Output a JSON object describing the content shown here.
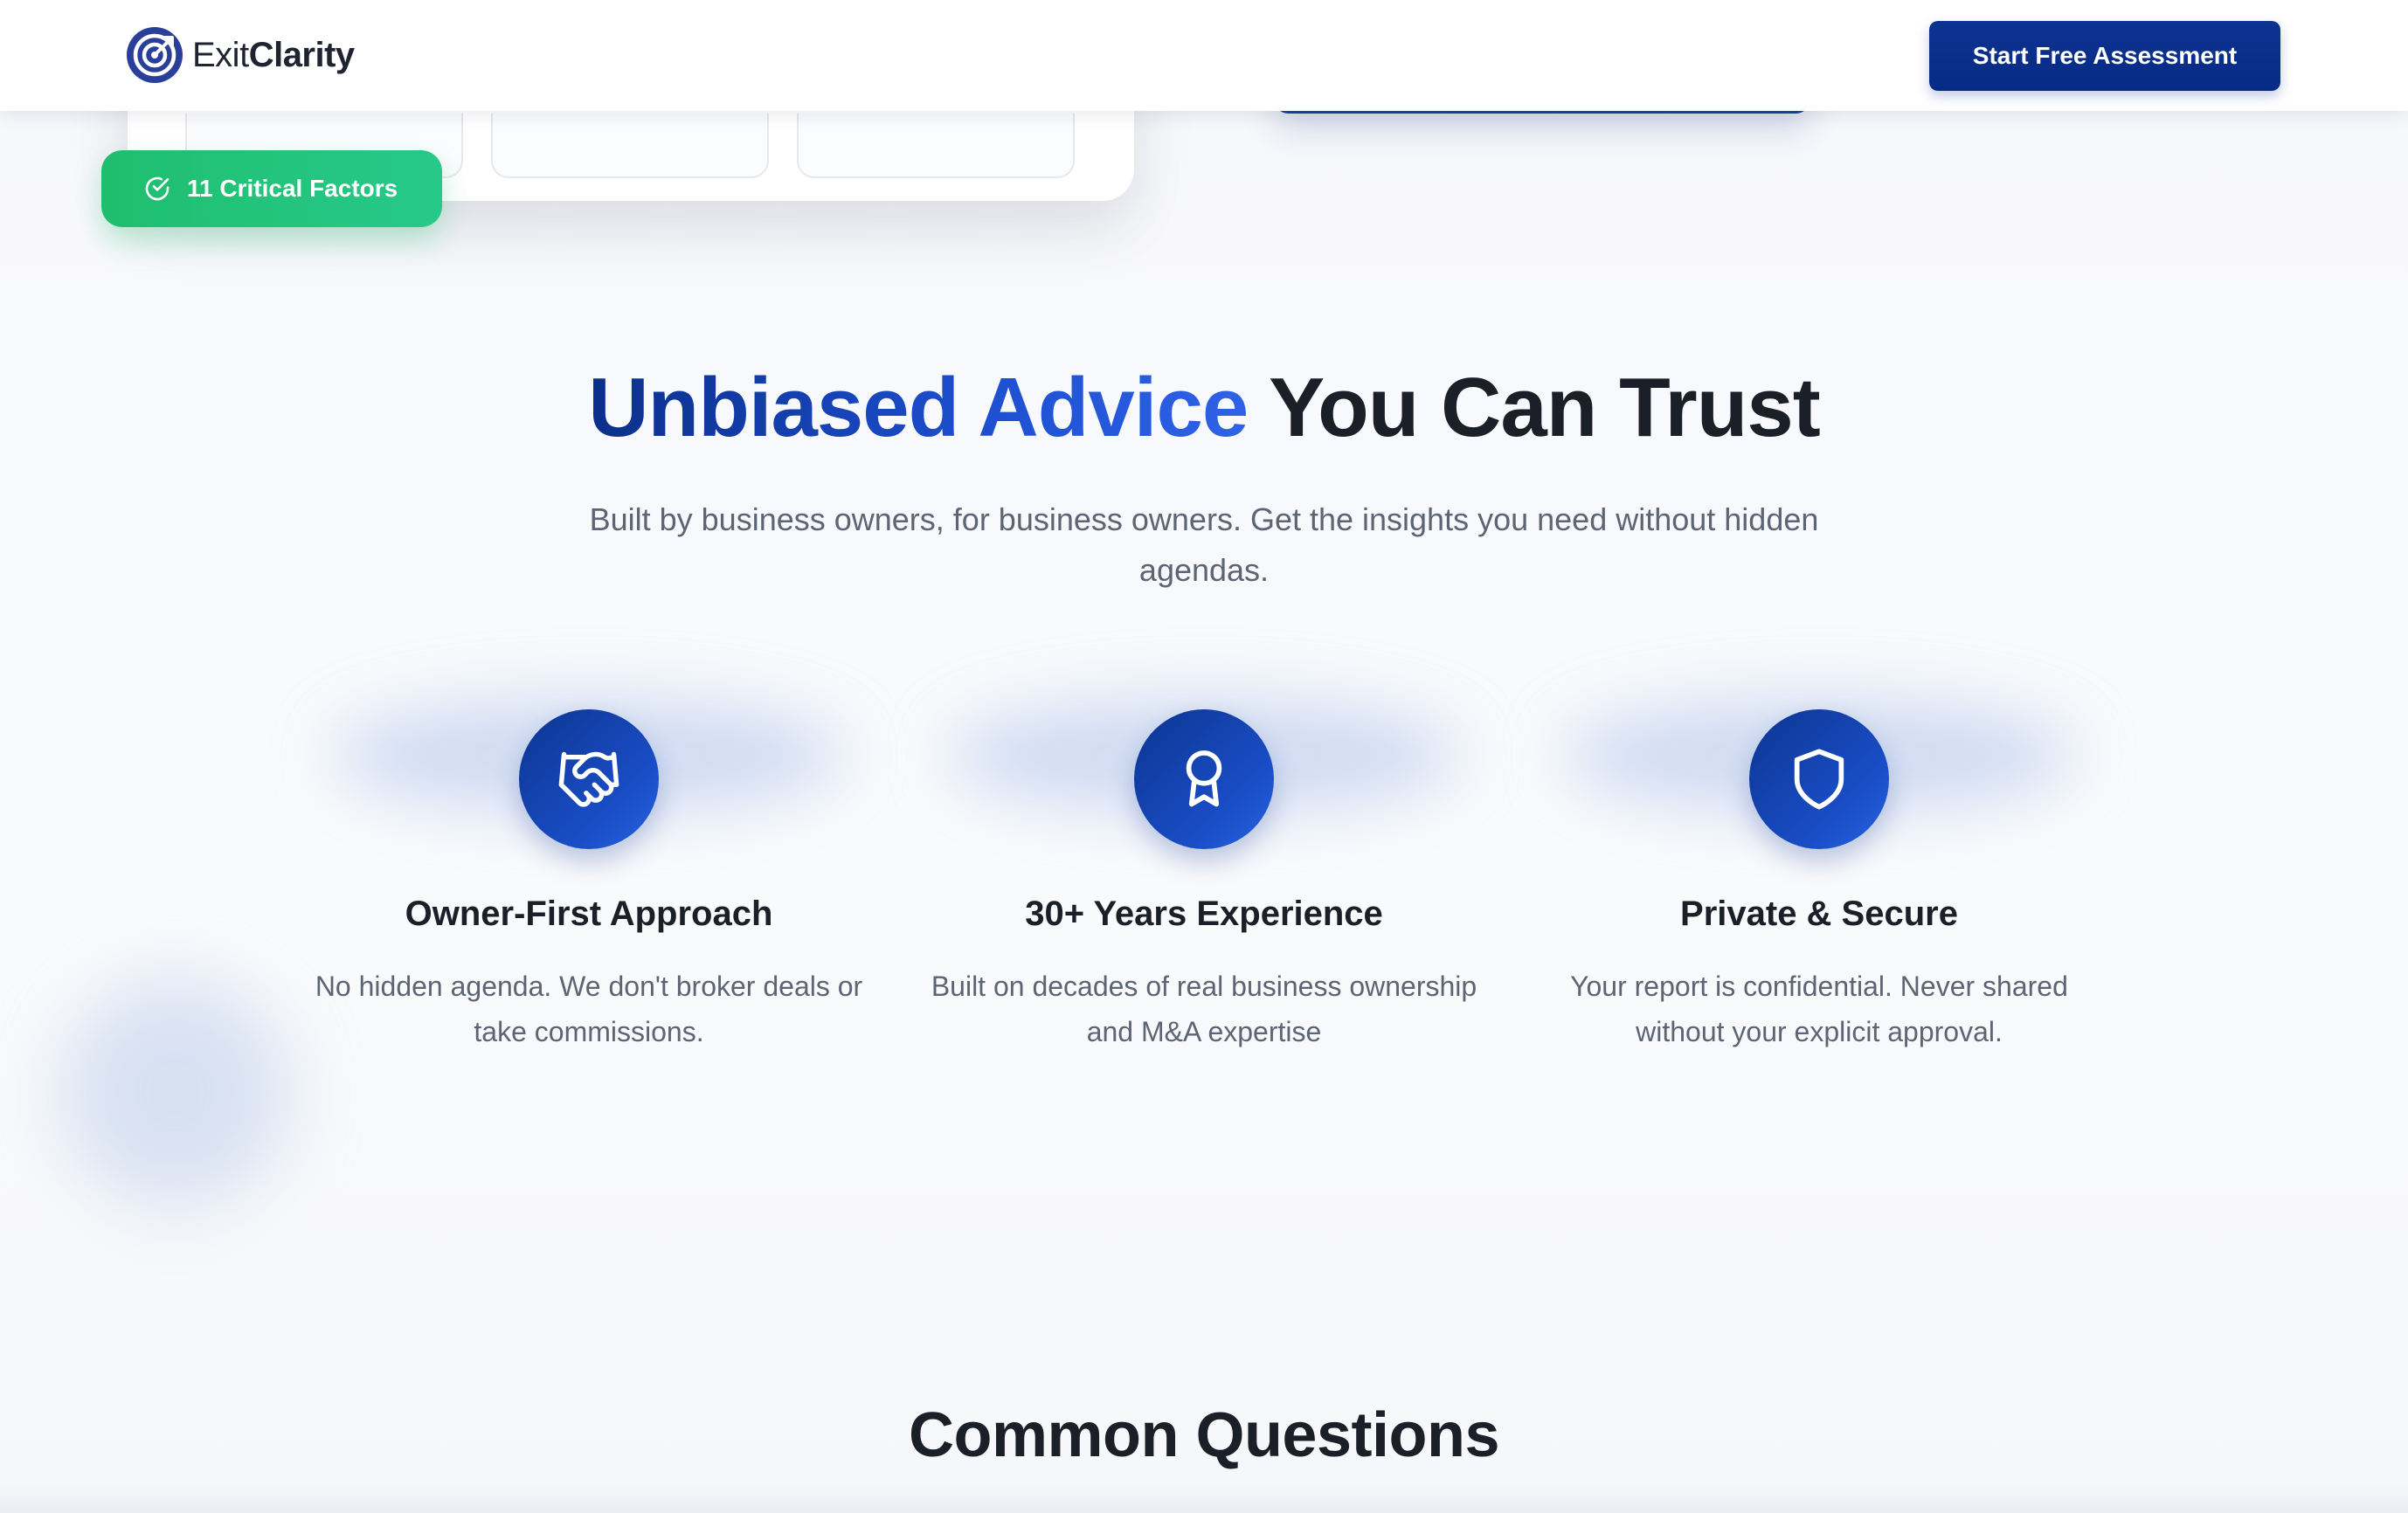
{
  "header": {
    "logo": {
      "part1": "Exit",
      "part2": "Clarity",
      "icon": "target-icon"
    },
    "cta_label": "Start Free Assessment"
  },
  "hero": {
    "badge_label": "11 Critical Factors",
    "badge_icon": "check-circle-icon"
  },
  "trust": {
    "title_highlight": "Unbiased Advice",
    "title_rest": "You Can Trust",
    "subtitle": "Built by business owners, for business owners. Get the insights you need without hidden agendas.",
    "features": [
      {
        "icon": "handshake-icon",
        "title": "Owner-First Approach",
        "text": "No hidden agenda. We don't broker deals or take commissions."
      },
      {
        "icon": "award-icon",
        "title": "30+ Years Experience",
        "text": "Built on decades of real business ownership and M&A expertise"
      },
      {
        "icon": "shield-icon",
        "title": "Private & Secure",
        "text": "Your report is confidential. Never shared without your explicit approval."
      }
    ]
  },
  "faq": {
    "title": "Common Questions"
  },
  "colors": {
    "brand_blue": "#062b86",
    "accent_blue": "#2f62e6",
    "success_green": "#1fbe6e"
  }
}
